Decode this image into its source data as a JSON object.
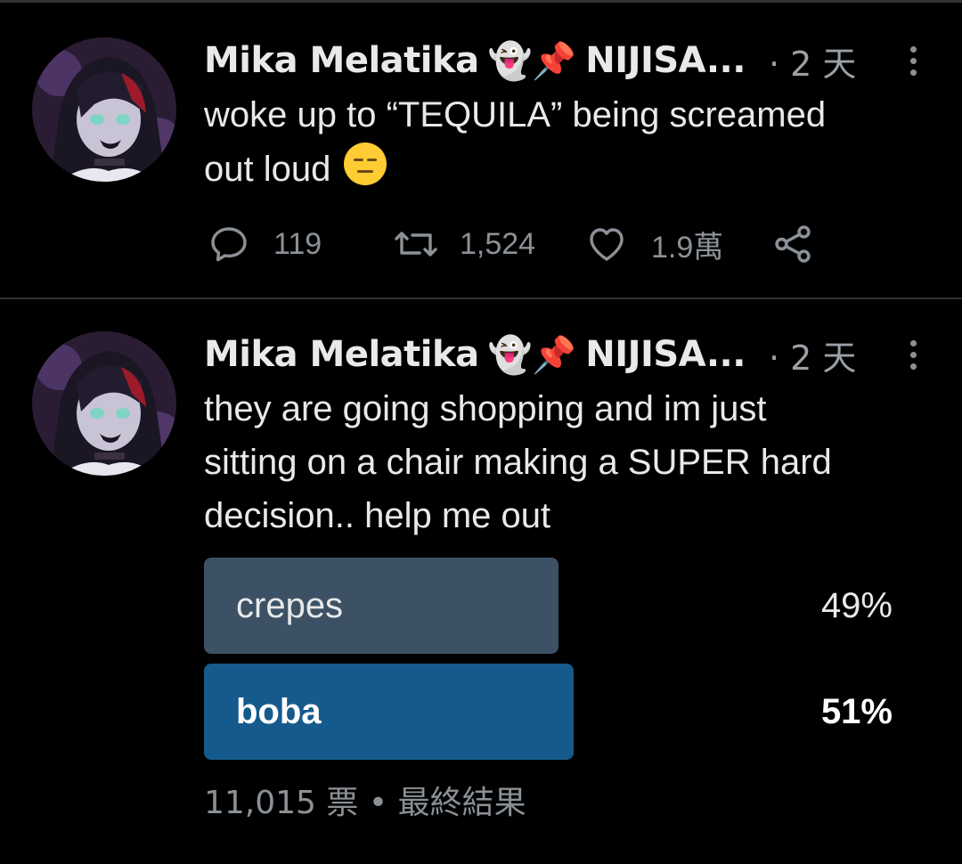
{
  "tweets": [
    {
      "author_name": "Mika Melatika",
      "author_emojis": "👻📌",
      "author_handle": "NIJISA...",
      "time": "· 2 天",
      "text_line1": "woke up to “TEQUILA” being screamed",
      "text_line2": "out loud",
      "text_emoji": "expressionless-face",
      "replies": "119",
      "retweets": "1,524",
      "likes": "1.9萬"
    },
    {
      "author_name": "Mika Melatika",
      "author_emojis": "👻📌",
      "author_handle": "NIJISA...",
      "time": "· 2 天",
      "text_line1": "they are going shopping and im just",
      "text_line2": "sitting on a chair making a SUPER hard",
      "text_line3": "decision.. help me out",
      "poll": {
        "options": [
          {
            "label": "crepes",
            "percent": "49%",
            "fraction": 0.49,
            "winner": false
          },
          {
            "label": "boba",
            "percent": "51%",
            "fraction": 0.51,
            "winner": true
          }
        ],
        "votes": "11,015 票",
        "separator": "•",
        "status": "最終結果"
      }
    }
  ],
  "colors": {
    "background": "#000000",
    "divider": "#2f3336",
    "text": "#e7e9ea",
    "muted": "#8b9196",
    "poll_loser": "#3c5164",
    "poll_winner": "#155a8c"
  }
}
